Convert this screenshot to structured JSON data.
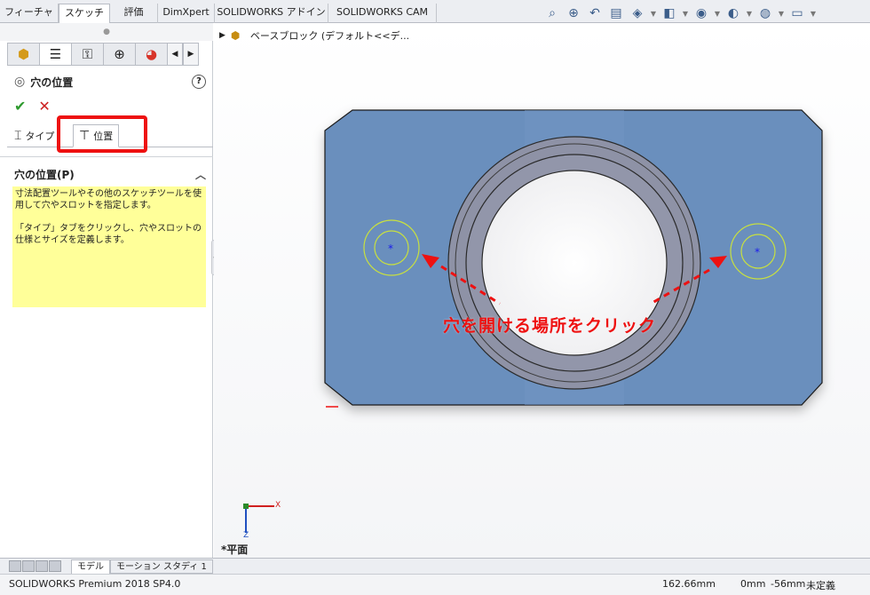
{
  "ribbon": {
    "tabs": [
      "フィーチャー",
      "スケッチ",
      "評価",
      "DimXpert",
      "SOLIDWORKS アドイン",
      "SOLIDWORKS CAM"
    ],
    "active": 1
  },
  "panel": {
    "title": "穴の位置",
    "help": "?",
    "ok": "✔",
    "cancel": "✕",
    "tab_type": "タイプ",
    "tab_position": "位置",
    "section_title": "穴の位置(P)",
    "info_line1": "寸法配置ツールやその他のスケッチツールを使用して穴やスロットを指定します。",
    "info_line2": "「タイプ」タブをクリックし、穴やスロットの仕様とサイズを定義します。"
  },
  "tree": {
    "label": "ベースブロック (デフォルト<<デ..."
  },
  "annotation": {
    "text": "穴を開ける場所をクリック",
    "color": "#ee1111"
  },
  "view": {
    "plane": "*平面",
    "axis_x": "X",
    "axis_z": "Z"
  },
  "bottom_tabs": [
    "モデル",
    "モーション スタディ 1"
  ],
  "status": {
    "product": "SOLIDWORKS Premium 2018 SP4.0",
    "x": "162.66mm",
    "y": "0mm",
    "z": "-56mm",
    "state": "未定義"
  },
  "colors": {
    "part_face": "#6a8fbd",
    "ring": "#8e92a6",
    "sketch_circle": "#c8e040",
    "point": "#1a1aee"
  }
}
